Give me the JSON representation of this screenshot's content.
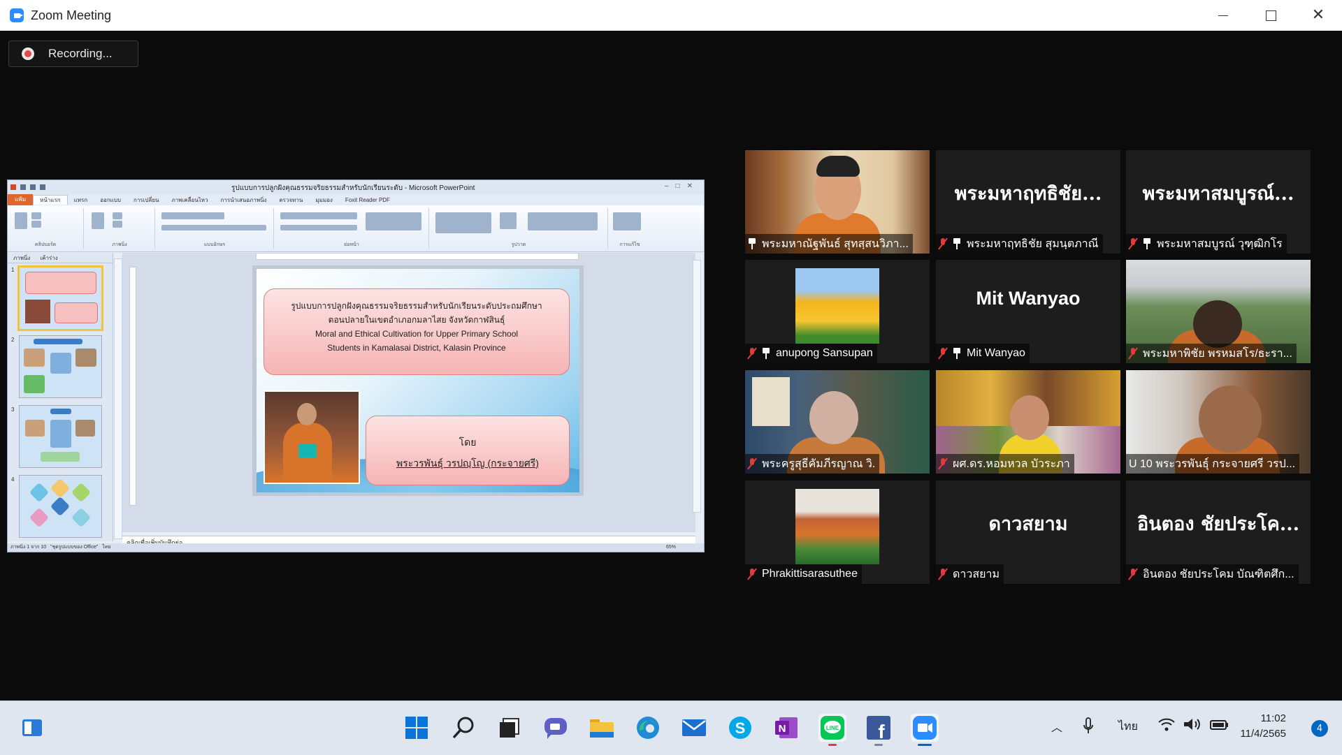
{
  "window": {
    "title": "Zoom Meeting"
  },
  "recording": {
    "label": "Recording..."
  },
  "shared_screen": {
    "app_title": "รูปแบบการปลูกฝังคุณธรรมจริยธรรมสำหรับนักเรียนระดับ - Microsoft PowerPoint",
    "ribbon_tabs": [
      "แฟ้ม",
      "หน้าแรก",
      "แทรก",
      "ออกแบบ",
      "การเปลี่ยน",
      "ภาพเคลื่อนไหว",
      "การนำเสนอภาพนิ่ง",
      "ตรวจทาน",
      "มุมมอง",
      "Foxit Reader PDF"
    ],
    "ribbon_groups": [
      "คลิปบอร์ด",
      "ภาพนิ่ง",
      "แบบอักษร",
      "ย่อหน้า",
      "รูปวาด",
      "การแก้ไข"
    ],
    "thumb_tabs": [
      "ภาพนิ่ง",
      "เค้าร่าง"
    ],
    "thumb_numbers": [
      "1",
      "2",
      "3",
      "4"
    ],
    "slide": {
      "title_th_line1": "รูปแบบการปลูกฝังคุณธรรมจริยธรรมสำหรับนักเรียนระดับประถมศึกษา",
      "title_th_line2": "ตอนปลายในเขตอำเภอกมลาไสย จังหวัดกาฬสินธุ์",
      "title_en_line1": "Moral and Ethical Cultivation for Upper Primary School",
      "title_en_line2": "Students in Kamalasai District, Kalasin Province",
      "by_label": "โดย",
      "author": "พระวรพันธุ์ วรปญฺโญ (กระจายศรี)"
    },
    "notes_placeholder": "คลิกเพื่อเพิ่มบันทึกย่อ",
    "status_slide": "ภาพนิ่ง 1 จาก 10",
    "status_theme": "\"ชุดรูปแบบของ Office\"",
    "status_lang": "ไทย",
    "zoom_level": "65%"
  },
  "participants": [
    {
      "big_name": "",
      "name": "พระมหาณัฐพันธ์ สุทสฺสนวิภา...",
      "muted": false,
      "pinned": true,
      "video": "video-man-orange"
    },
    {
      "big_name": "พระมหาฤทธิชัย...",
      "name": "พระมหาฤทธิชัย สุมนฺตภาณี",
      "muted": true,
      "pinned": true,
      "video": ""
    },
    {
      "big_name": "พระมหาสมบูรณ์...",
      "name": "พระมหาสมบูรณ์ วุฑฺฒิกโร",
      "muted": true,
      "pinned": true,
      "video": ""
    },
    {
      "big_name": "",
      "name": "anupong Sansupan",
      "muted": true,
      "pinned": true,
      "video": "tulips-picture"
    },
    {
      "big_name": "Mit Wanyao",
      "name": "Mit Wanyao",
      "muted": true,
      "pinned": true,
      "video": ""
    },
    {
      "big_name": "",
      "name": "พระมหาพิชัย พรหมสโร/ธะรา...",
      "muted": true,
      "pinned": false,
      "video": "video-monk-outdoor"
    },
    {
      "big_name": "",
      "name": "พระครูสุธีคัมภีรญาณ วิ.",
      "muted": true,
      "pinned": false,
      "video": "video-monk-shrine"
    },
    {
      "big_name": "",
      "name": "ผศ.ดร.หอมหวล บัวระภา",
      "muted": true,
      "pinned": false,
      "video": "video-man-yellow"
    },
    {
      "big_name": "",
      "name": "U 10 พระวรพันธุ์ กระจายศรี วรป...",
      "muted": false,
      "pinned": false,
      "video": "video-monk-indoor",
      "active_speaker": true
    },
    {
      "big_name": "",
      "name": "Phrakittisarasuthee",
      "muted": true,
      "pinned": false,
      "video": "temple-picture"
    },
    {
      "big_name": "ดาวสยาม",
      "name": "ดาวสยาม",
      "muted": true,
      "pinned": false,
      "video": ""
    },
    {
      "big_name": "อินตอง ชัยประโค...",
      "name": "อินตอง ชัยประโคม บัณฑิตศึก...",
      "muted": true,
      "pinned": false,
      "video": ""
    }
  ],
  "taskbar": {
    "icons": [
      "start-icon",
      "search-icon",
      "task-view-icon",
      "chat-icon",
      "file-explorer-icon",
      "edge-icon",
      "mail-icon",
      "skype-icon",
      "onenote-icon",
      "line-icon",
      "facebook-icon",
      "zoom-icon"
    ],
    "language": "ไทย",
    "time": "11:02",
    "date": "11/4/2565",
    "notification_count": "4"
  },
  "colors": {
    "zoom_blue": "#2d8cff",
    "muted_red": "#e23b3b",
    "active_speaker": "#e6e83c",
    "windows_blue": "#0067c0"
  }
}
